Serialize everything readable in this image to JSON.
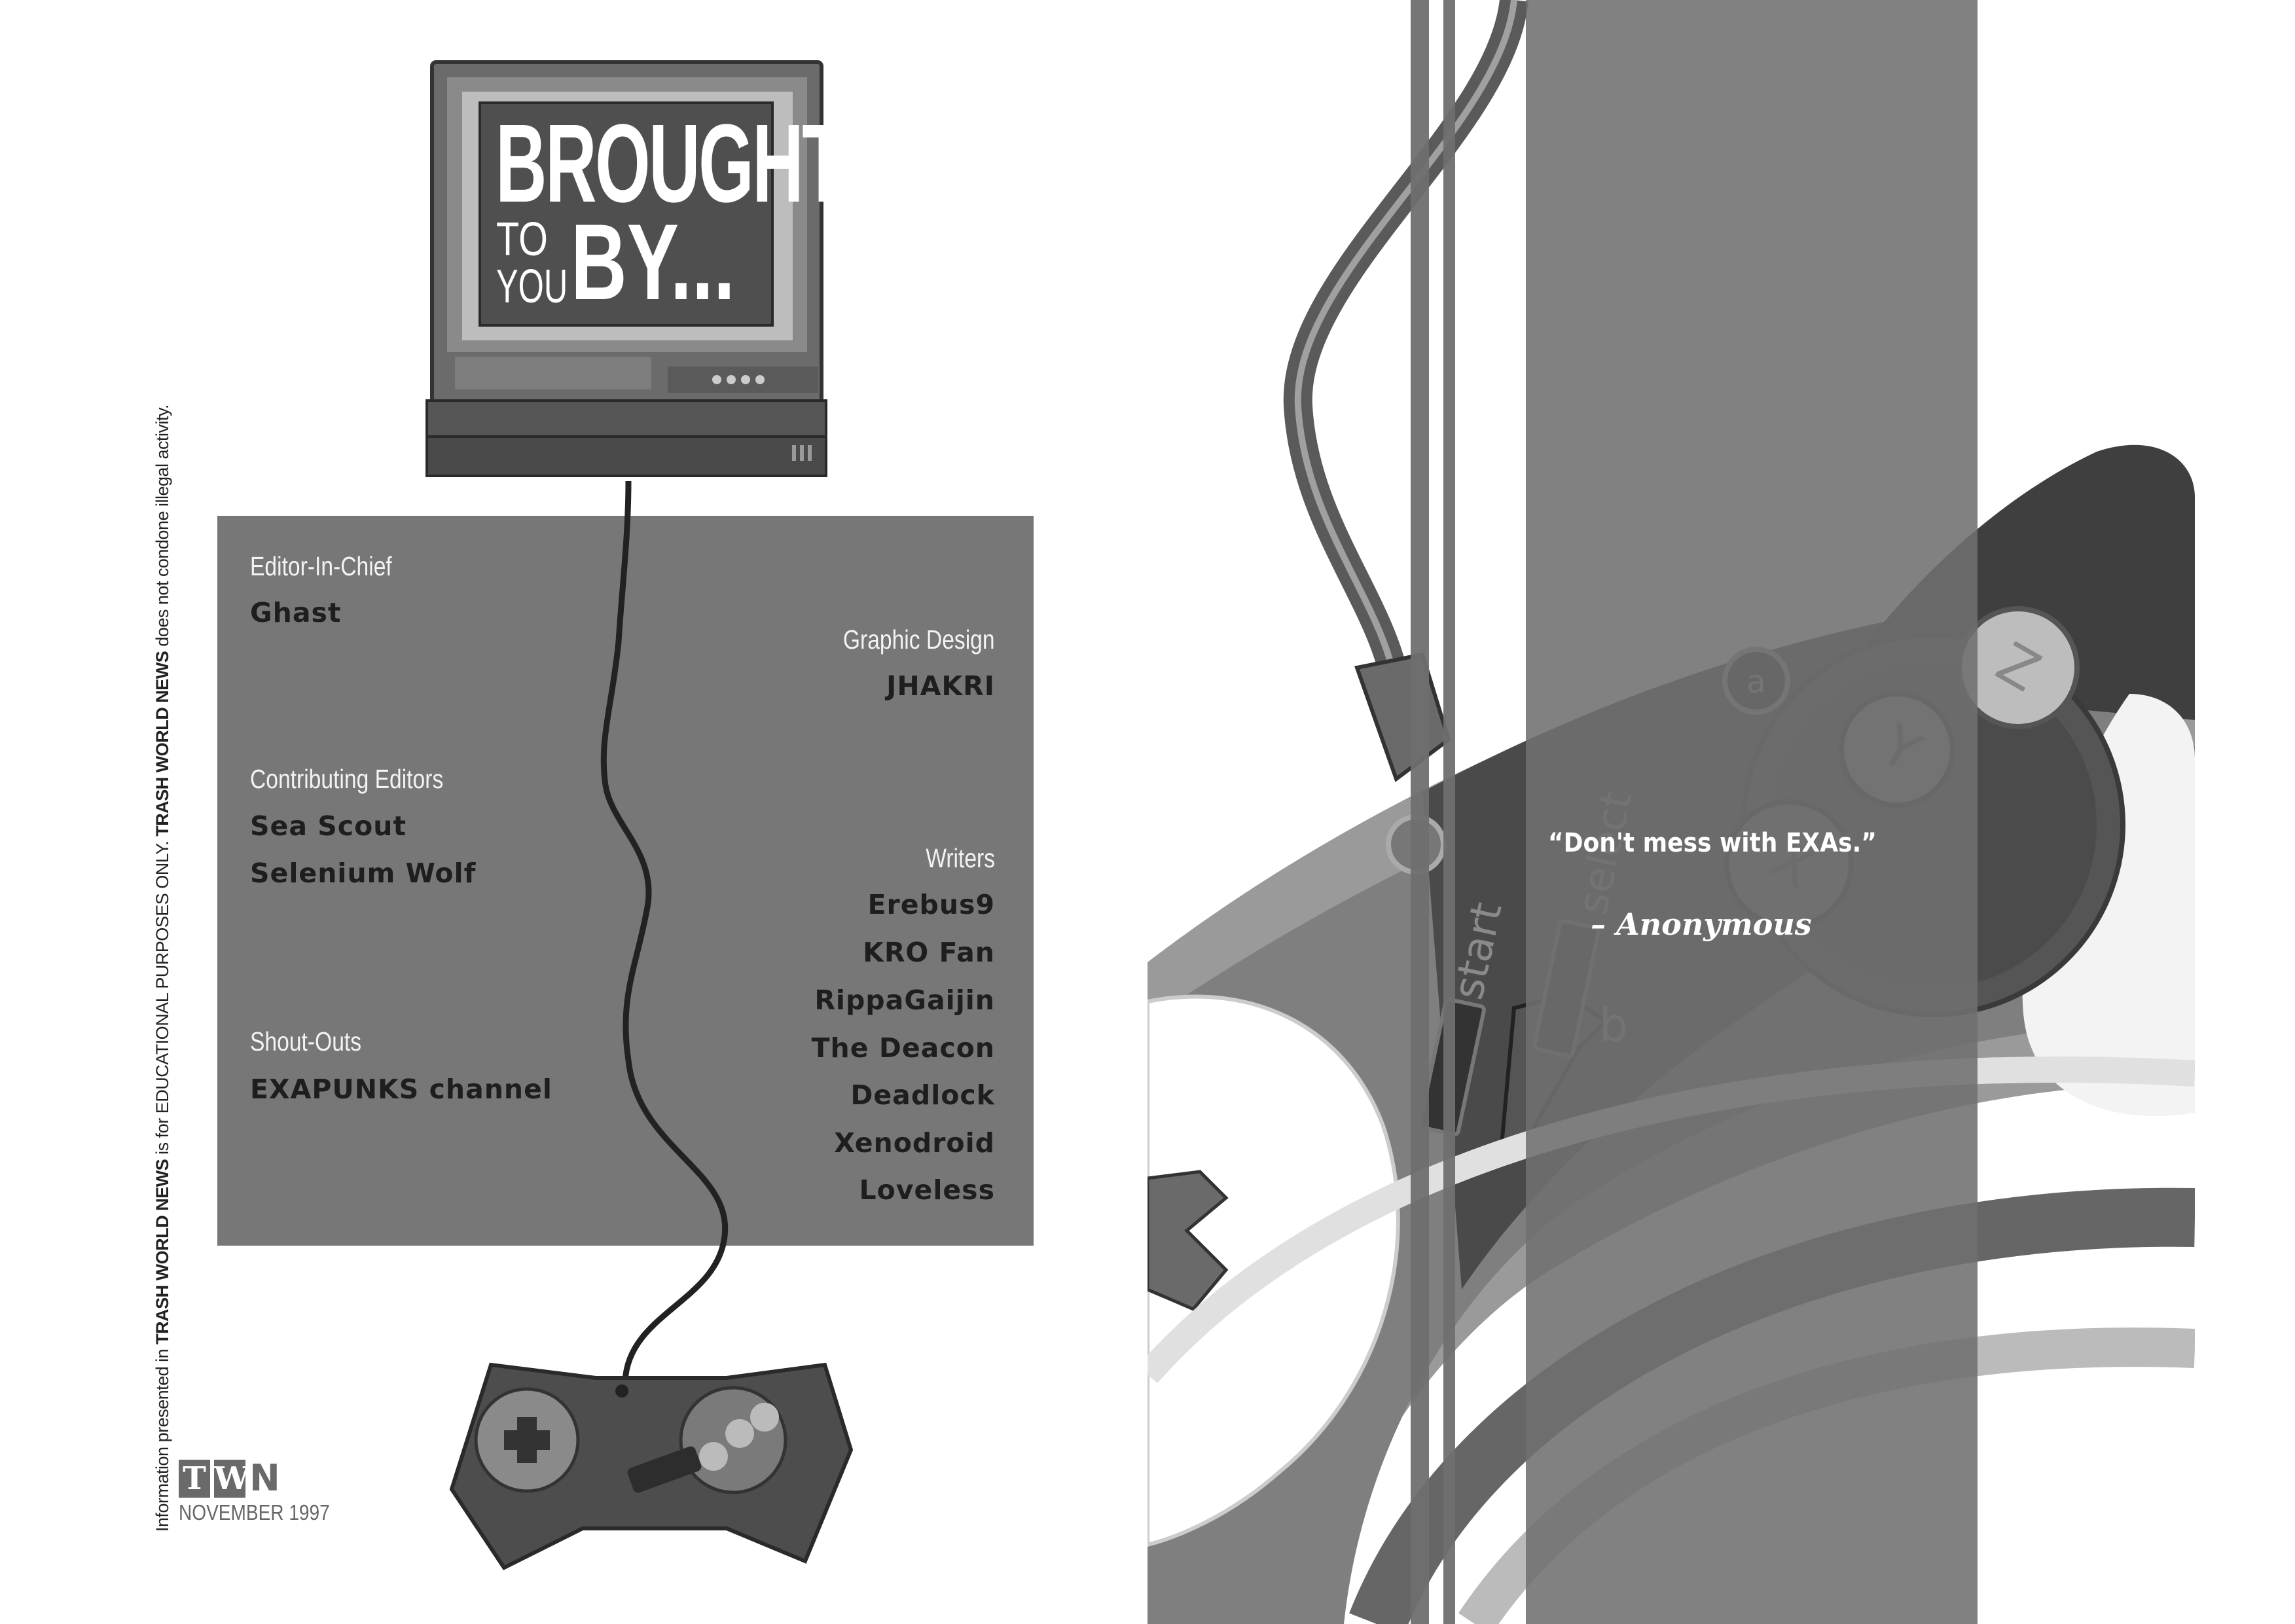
{
  "tv_screen": {
    "line1": "BROUGHT",
    "to_word": "TO",
    "you_word": "YOU",
    "by_word": "BY..."
  },
  "credits": {
    "editor_in_chief": {
      "label": "Editor-In-Chief",
      "names": [
        "Ghast"
      ]
    },
    "contributing_editors": {
      "label": "Contributing Editors",
      "names": [
        "Sea Scout",
        "Selenium Wolf"
      ]
    },
    "shout_outs": {
      "label": "Shout-Outs",
      "names": [
        "EXAPUNKS channel"
      ]
    },
    "graphic_design": {
      "label": "Graphic Design",
      "names": [
        "JHAKRI"
      ]
    },
    "writers": {
      "label": "Writers",
      "names": [
        "Erebus9",
        "KRO Fan",
        "RippaGaijin",
        "The Deacon",
        "Deadlock",
        "Xenodroid",
        "Loveless"
      ]
    }
  },
  "disclaimer": {
    "part1": "Information presented in ",
    "brand1": "TRASH WORLD NEWS",
    "part2": " is for EDUCATIONAL PURPOSES ONLY.  ",
    "brand2": "TRASH WORLD NEWS",
    "part3": " does not condone illegal activity."
  },
  "logo": {
    "letters": [
      "T",
      "W",
      "N"
    ],
    "issue": "NOVEMBER 1997"
  },
  "quote": {
    "text": "“Don't mess with EXAs.”",
    "author": "– Anonymous"
  },
  "controller_labels": {
    "start": "start",
    "select": "select",
    "a": "a",
    "b": "b",
    "x": "X",
    "y": "Y",
    "z": "Z"
  },
  "colors": {
    "panel": "#777777",
    "stripe": "#6f6f6f",
    "dark": "#3a3a3a"
  }
}
